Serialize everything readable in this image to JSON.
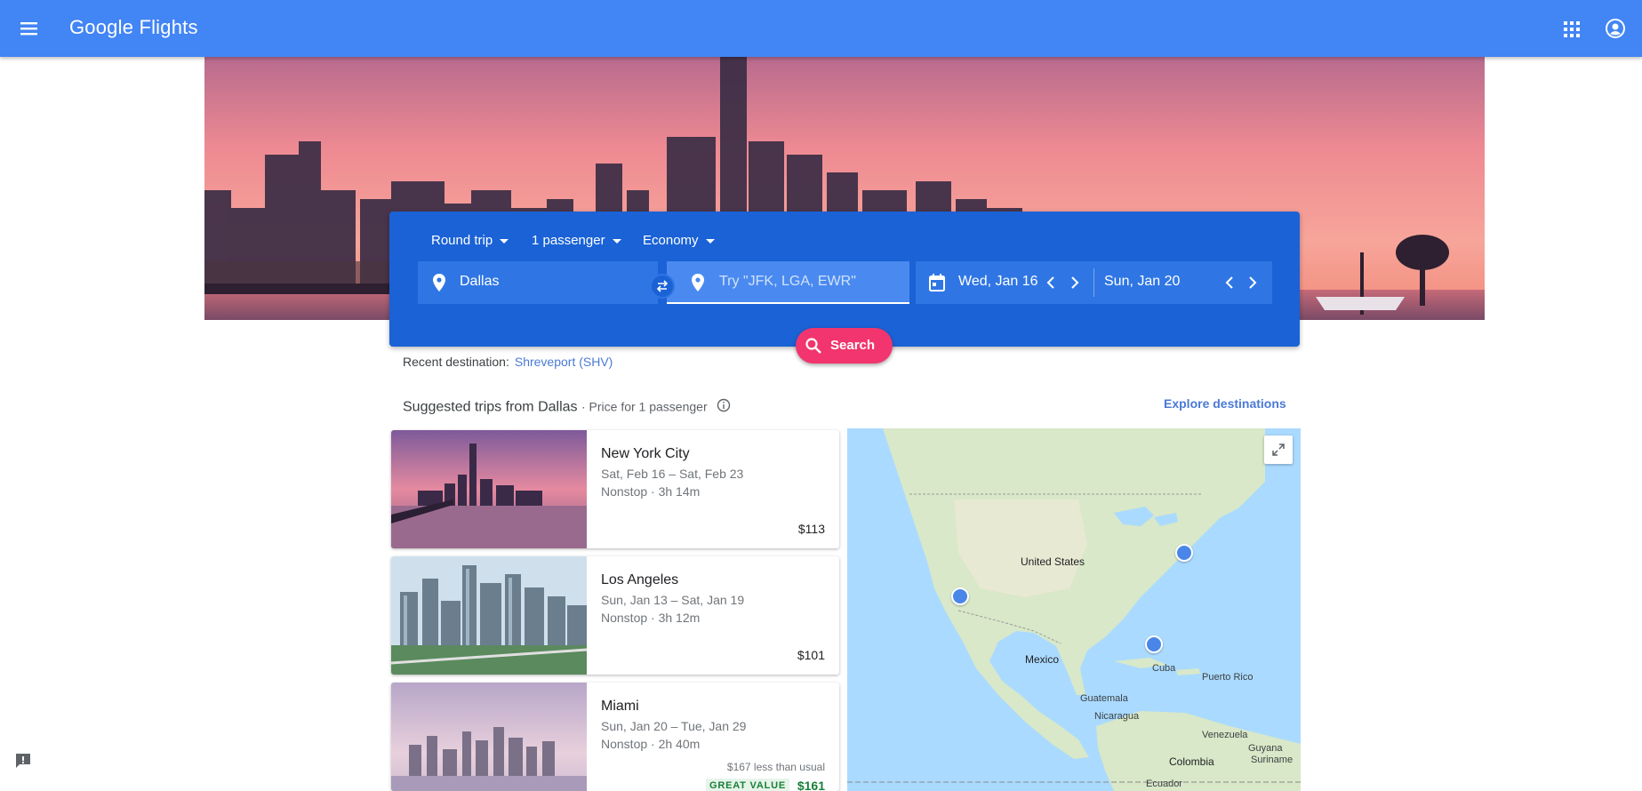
{
  "app": {
    "title": "Google Flights"
  },
  "icons": {
    "menu": "menu-icon",
    "apps": "apps-grid-icon",
    "account": "account-icon",
    "origin": "location-pin-icon",
    "destination": "location-pin-icon",
    "swap": "swap-icon",
    "calendar": "calendar-icon",
    "search": "search-icon",
    "info": "info-icon",
    "expand": "expand-icon",
    "feedback": "feedback-icon"
  },
  "colors": {
    "appbar": "#4285f4",
    "panel": "#1a62d6",
    "search_button": "#f2356e",
    "link": "#4a7ad6",
    "great_value": "#188038"
  },
  "search": {
    "trip_type": "Round trip",
    "passengers": "1 passenger",
    "cabin": "Economy",
    "origin": "Dallas",
    "destination_placeholder": "Try \"JFK, LGA, EWR\"",
    "depart_date": "Wed, Jan 16",
    "return_date": "Sun, Jan 20",
    "search_label": "Search"
  },
  "recent": {
    "label": "Recent destination:",
    "destination": "Shreveport (SHV)"
  },
  "suggested": {
    "title": "Suggested trips from Dallas",
    "subtitle": "· Price for 1 passenger",
    "explore_label": "Explore destinations",
    "trips": [
      {
        "city": "New York City",
        "dates": "Sat, Feb 16 – Sat, Feb 23",
        "stops": "Nonstop · 3h 14m",
        "price": "$113"
      },
      {
        "city": "Los Angeles",
        "dates": "Sun, Jan 13 – Sat, Jan 19",
        "stops": "Nonstop · 3h 12m",
        "price": "$101"
      },
      {
        "city": "Miami",
        "dates": "Sun, Jan 20 – Tue, Jan 29",
        "stops": "Nonstop · 2h 40m",
        "saving": "$167 less than usual",
        "badge": "GREAT VALUE",
        "price": "$161"
      }
    ]
  },
  "map": {
    "labels": [
      "United States",
      "Mexico",
      "Cuba",
      "Puerto Rico",
      "Guatemala",
      "Nicaragua",
      "Venezuela",
      "Guyana",
      "Suriname",
      "Colombia",
      "Ecuador"
    ]
  }
}
